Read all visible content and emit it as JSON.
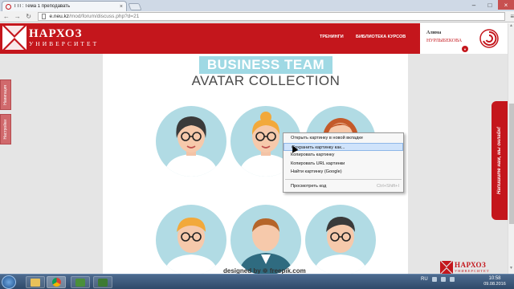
{
  "browser": {
    "tab_title": "ТТГ: Тема 1 преподавать",
    "tab_close": "×",
    "url_host": "e.neu.kz",
    "url_path": "/mod/forum/discuss.php?d=21",
    "min": "–",
    "max": "□",
    "close": "×",
    "back": "←",
    "forward": "→",
    "reload": "↻",
    "menu": "≡"
  },
  "site": {
    "logo_main": "НАРХОЗ",
    "logo_sub": "УНИВЕРСИТЕТ",
    "nav": [
      "ТРЕНИНГИ",
      "БИБЛИОТЕКА КУРСОВ"
    ],
    "user_first": "Алима",
    "user_last": "НУРЛЫБЕКОВА",
    "user_dd": "▼",
    "side_tabs": [
      "Навигация",
      "Настройки"
    ],
    "help_tab": "Напишите нам, мы онлайн!",
    "corner_main": "НАРХОЗ",
    "corner_sub": "УНИВЕРСИТЕТ",
    "brand_color": "#c4161c"
  },
  "poster": {
    "title_line1": "BUSINESS TEAM",
    "title_line2": "AVATAR COLLECTION",
    "footer": "designed by ❁ freepik.com"
  },
  "context_menu": {
    "items": [
      {
        "label": "Открыть картинку в новой вкладке",
        "shortcut": ""
      },
      {
        "label": "Сохранить картинку как...",
        "shortcut": ""
      },
      {
        "label": "Копировать картинку",
        "shortcut": ""
      },
      {
        "label": "Копировать URL картинки",
        "shortcut": ""
      },
      {
        "label": "Найти картинку (Google)",
        "shortcut": ""
      },
      {
        "label": "Просмотреть код",
        "shortcut": "Ctrl+Shift+I"
      }
    ],
    "highlighted_index": 1
  },
  "scrollbar": {
    "up": "▲",
    "down": "▼"
  },
  "taskbar": {
    "lang": "RU",
    "time": "10:58",
    "date": "09.08.2016"
  }
}
